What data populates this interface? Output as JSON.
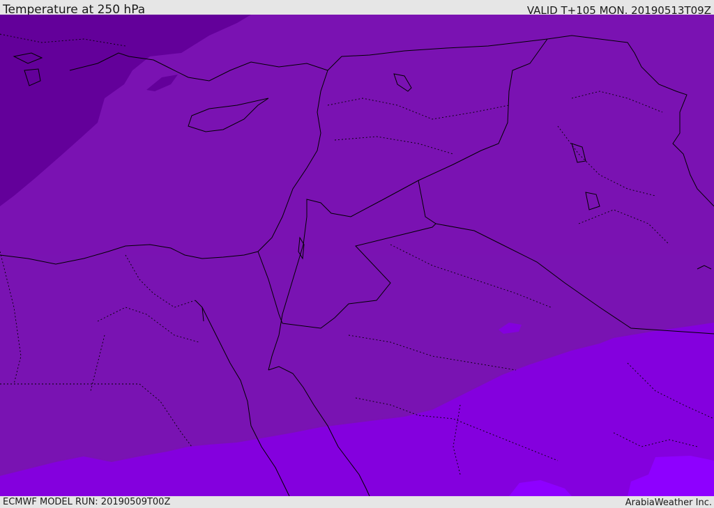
{
  "header": {
    "title": "Temperature at 250 hPa",
    "valid": "VALID T+105 MON. 20190513T09Z"
  },
  "footer": {
    "model_run": "ECMWF MODEL RUN: 20190509T00Z",
    "credit": "ArabiaWeather Inc."
  },
  "map": {
    "field": "temperature",
    "level": "250 hPa",
    "bands": [
      {
        "name": "coldest",
        "color": "#63009a"
      },
      {
        "name": "cold",
        "color": "#7a10b0"
      },
      {
        "name": "mid",
        "color": "#7a13b4"
      },
      {
        "name": "mild",
        "color": "#8400de"
      },
      {
        "name": "warmest",
        "color": "#8e00ff"
      }
    ],
    "border_color": "#000000"
  }
}
